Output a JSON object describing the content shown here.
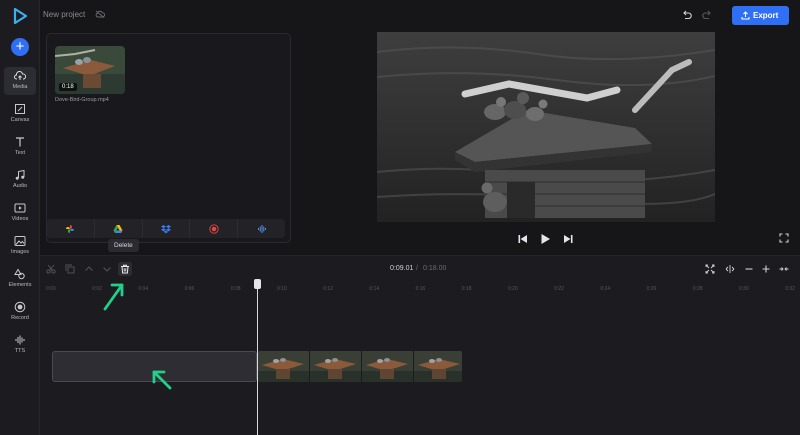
{
  "app": {
    "project_title": "New project",
    "export_label": "Export",
    "accent_color": "#2f6ff5"
  },
  "sidebar": {
    "items": [
      {
        "label": "Media",
        "icon": "cloud-upload-icon",
        "active": true
      },
      {
        "label": "Canvas",
        "icon": "canvas-icon"
      },
      {
        "label": "Text",
        "icon": "text-icon"
      },
      {
        "label": "Audio",
        "icon": "music-note-icon"
      },
      {
        "label": "Videos",
        "icon": "video-icon"
      },
      {
        "label": "Images",
        "icon": "image-icon"
      },
      {
        "label": "Elements",
        "icon": "shapes-icon"
      },
      {
        "label": "Record",
        "icon": "record-icon"
      },
      {
        "label": "TTS",
        "icon": "waveform-icon"
      }
    ]
  },
  "media": {
    "file_name": "Dove-Bird-Group.mp4",
    "duration": "0:18",
    "sources": [
      "google-photos-icon",
      "google-drive-icon",
      "dropbox-icon",
      "record-icon",
      "audio-wave-icon"
    ]
  },
  "timeline": {
    "tooltip": "Delete",
    "current_time": "0:09.01",
    "separator": "/",
    "total_time": "0:18.00",
    "ticks": [
      "0:00",
      "0:02",
      "0:04",
      "0:06",
      "0:08",
      "0:10",
      "0:12",
      "0:14",
      "0:16",
      "0:18",
      "0:20",
      "0:22",
      "0:24",
      "0:26",
      "0:28",
      "0:30",
      "0:32"
    ]
  }
}
